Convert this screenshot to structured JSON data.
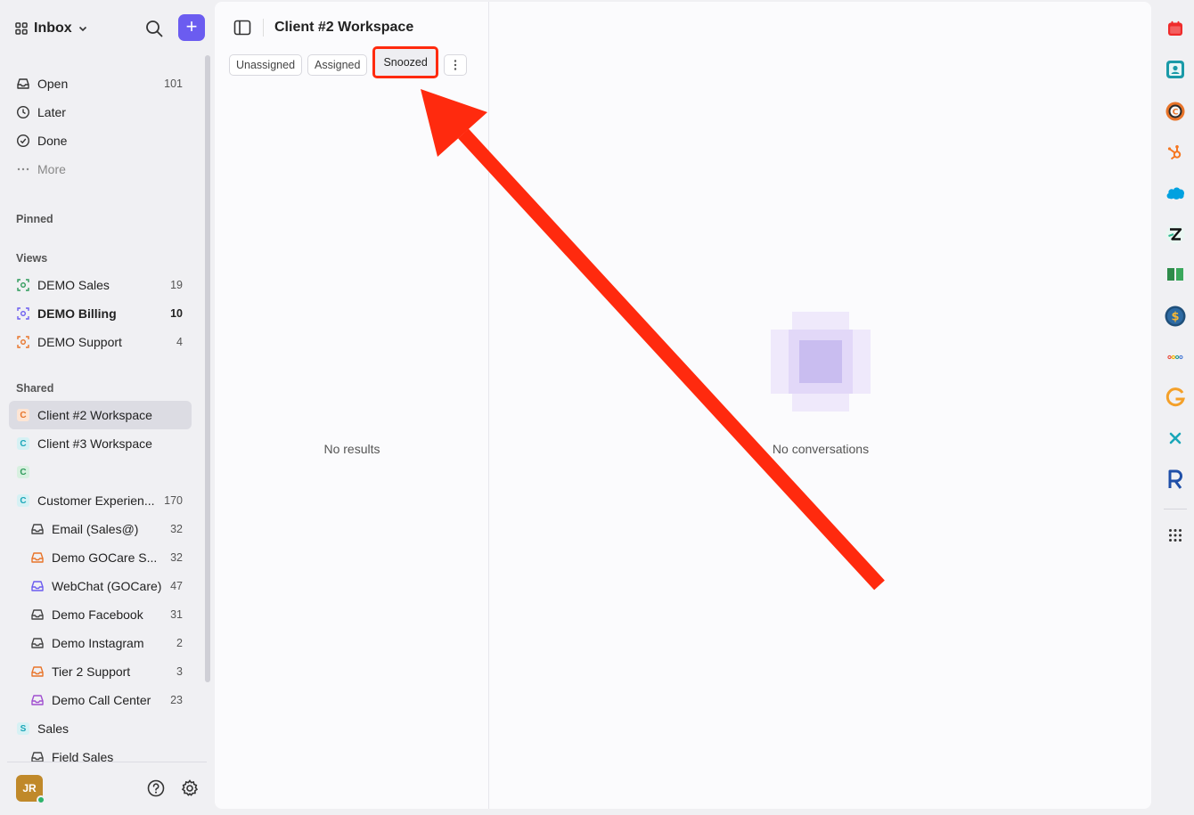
{
  "sidebar": {
    "title": "Inbox",
    "main_items": [
      {
        "label": "Open",
        "count": "101"
      },
      {
        "label": "Later",
        "count": ""
      },
      {
        "label": "Done",
        "count": ""
      },
      {
        "label": "More",
        "count": ""
      }
    ],
    "pinned_label": "Pinned",
    "views_label": "Views",
    "views": [
      {
        "label": "DEMO Sales",
        "count": "19",
        "color": "#2e9a5a"
      },
      {
        "label": "DEMO Billing",
        "count": "10",
        "color": "#6b5cf0"
      },
      {
        "label": "DEMO Support",
        "count": "4",
        "color": "#e8742a"
      }
    ],
    "shared_label": "Shared",
    "shared": [
      {
        "label": "Client #2 Workspace",
        "count": "",
        "badge": "C",
        "badge_color": "#e8742a"
      },
      {
        "label": "Client #3 Workspace",
        "count": "",
        "badge": "C",
        "badge_color": "#1aa6b8"
      },
      {
        "label": "",
        "count": "",
        "badge": "C",
        "badge_color": "#2e9a5a"
      },
      {
        "label": "Customer Experien...",
        "count": "170",
        "badge": "C",
        "badge_color": "#1aa6b8"
      }
    ],
    "inboxes": [
      {
        "label": "Email (Sales@)",
        "count": "32",
        "color": "#444"
      },
      {
        "label": "Demo GOCare S...",
        "count": "32",
        "color": "#e8742a"
      },
      {
        "label": "WebChat (GOCare)",
        "count": "47",
        "color": "#6b5cf0"
      },
      {
        "label": "Demo Facebook",
        "count": "31",
        "color": "#444"
      },
      {
        "label": "Demo Instagram",
        "count": "2",
        "color": "#444"
      },
      {
        "label": "Tier 2 Support",
        "count": "3",
        "color": "#e8742a"
      },
      {
        "label": "Demo Call Center",
        "count": "23",
        "color": "#a04fd0"
      }
    ],
    "sales": {
      "label": "Sales",
      "badge": "S",
      "badge_color": "#1aa6b8"
    },
    "field_sales": {
      "label": "Field Sales"
    },
    "user_initials": "JR"
  },
  "main": {
    "workspace_title": "Client #2 Workspace",
    "tabs": [
      {
        "label": "Unassigned"
      },
      {
        "label": "Assigned"
      },
      {
        "label": "Snoozed"
      }
    ],
    "no_results": "No results",
    "no_conversations": "No conversations"
  },
  "rail": {
    "apps": [
      "calendar-icon",
      "contacts-icon",
      "circle-c-icon",
      "hubspot-icon",
      "salesforce-icon",
      "zendesk-icon",
      "book-icon",
      "dollar-icon",
      "dots-app-icon",
      "g-icon",
      "x-icon",
      "r-icon",
      "grid-icon"
    ]
  },
  "colors": {
    "accent": "#6b5cf0",
    "annotation": "#ff2a0e"
  }
}
